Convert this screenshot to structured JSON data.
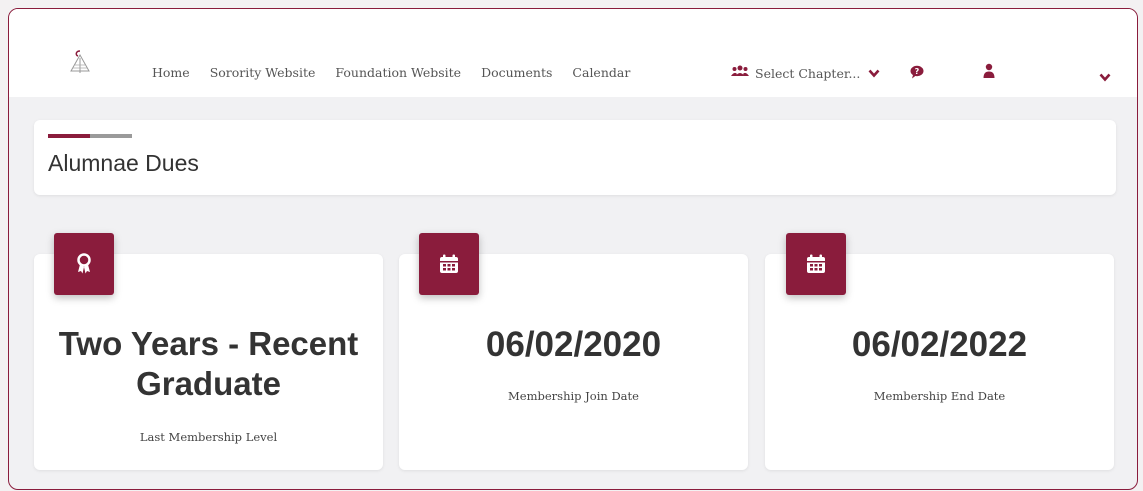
{
  "nav": {
    "links": [
      "Home",
      "Sorority Website",
      "Foundation Website",
      "Documents",
      "Calendar"
    ],
    "chapter_select": "Select Chapter..."
  },
  "page": {
    "title": "Alumnae Dues"
  },
  "cards": [
    {
      "value": "Two Years - Recent Graduate",
      "label": "Last Membership Level",
      "icon": "award-icon"
    },
    {
      "value": "06/02/2020",
      "label": "Membership Join Date",
      "icon": "calendar-icon"
    },
    {
      "value": "06/02/2022",
      "label": "Membership End Date",
      "icon": "calendar-icon"
    }
  ],
  "colors": {
    "accent": "#8a1c3c",
    "secondary": "#9a9a9a"
  }
}
